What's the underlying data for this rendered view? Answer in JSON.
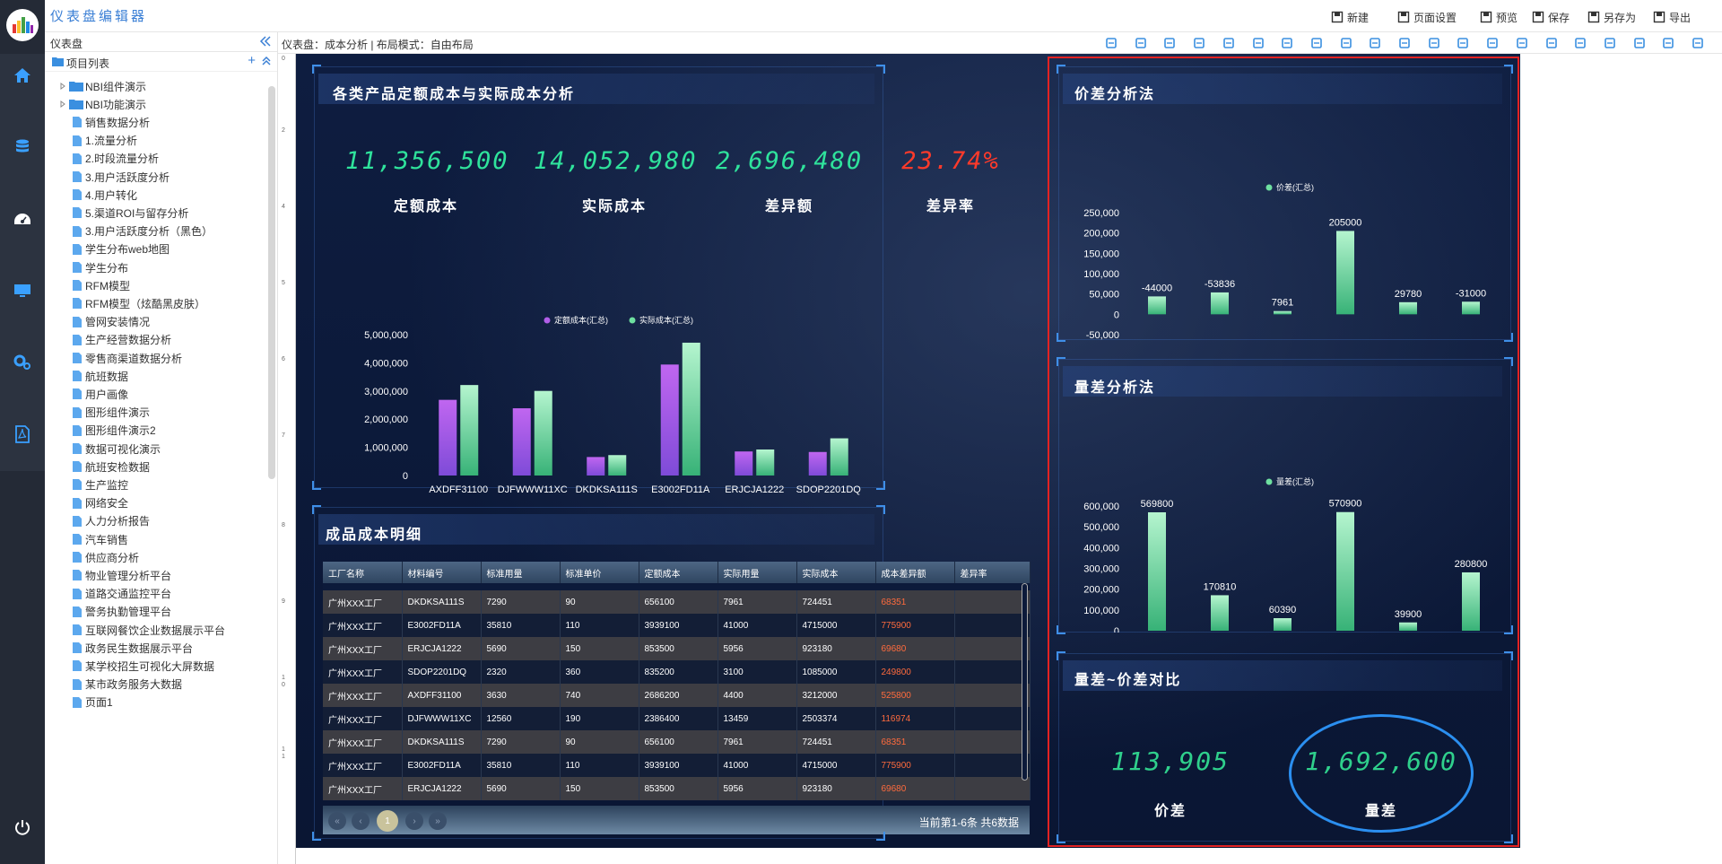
{
  "app": {
    "title": "仪表盘编辑器"
  },
  "toolbar": [
    {
      "key": "new",
      "label": "新建",
      "icon": "new-icon"
    },
    {
      "key": "page-settings",
      "label": "页面设置",
      "icon": "page-settings-icon"
    },
    {
      "key": "preview",
      "label": "预览",
      "icon": "eye-icon"
    },
    {
      "key": "save",
      "label": "保存",
      "icon": "save-icon"
    },
    {
      "key": "save-as",
      "label": "另存为",
      "icon": "save-as-icon"
    },
    {
      "key": "export",
      "label": "导出",
      "icon": "export-icon"
    }
  ],
  "sidebar": {
    "header": "仪表盘",
    "project_list_label": "项目列表",
    "items": [
      {
        "label": "NBI组件演示",
        "type": "folder"
      },
      {
        "label": "NBI功能演示",
        "type": "folder"
      },
      {
        "label": "销售数据分析",
        "type": "doc"
      },
      {
        "label": "1.流量分析",
        "type": "doc"
      },
      {
        "label": "2.时段流量分析",
        "type": "doc"
      },
      {
        "label": "3.用户活跃度分析",
        "type": "doc"
      },
      {
        "label": "4.用户转化",
        "type": "doc"
      },
      {
        "label": "5.渠道ROI与留存分析",
        "type": "doc"
      },
      {
        "label": "3.用户活跃度分析（黑色）",
        "type": "doc"
      },
      {
        "label": "学生分布web地图",
        "type": "doc"
      },
      {
        "label": "学生分布",
        "type": "doc"
      },
      {
        "label": "RFM模型",
        "type": "doc"
      },
      {
        "label": "RFM模型（炫酷黑皮肤）",
        "type": "doc"
      },
      {
        "label": "管网安装情况",
        "type": "doc"
      },
      {
        "label": "生产经营数据分析",
        "type": "doc"
      },
      {
        "label": "零售商渠道数据分析",
        "type": "doc"
      },
      {
        "label": "航班数据",
        "type": "doc"
      },
      {
        "label": "用户画像",
        "type": "doc"
      },
      {
        "label": "图形组件演示",
        "type": "doc"
      },
      {
        "label": "图形组件演示2",
        "type": "doc"
      },
      {
        "label": "数据可视化演示",
        "type": "doc"
      },
      {
        "label": "航班安检数据",
        "type": "doc"
      },
      {
        "label": "生产监控",
        "type": "doc"
      },
      {
        "label": "网络安全",
        "type": "doc"
      },
      {
        "label": "人力分析报告",
        "type": "doc"
      },
      {
        "label": "汽车销售",
        "type": "doc"
      },
      {
        "label": "供应商分析",
        "type": "doc"
      },
      {
        "label": "物业管理分析平台",
        "type": "doc"
      },
      {
        "label": "道路交通监控平台",
        "type": "doc"
      },
      {
        "label": "警务执勤管理平台",
        "type": "doc"
      },
      {
        "label": "互联网餐饮企业数据展示平台",
        "type": "doc"
      },
      {
        "label": "政务民生数据展示平台",
        "type": "doc"
      },
      {
        "label": "某学校招生可视化大屏数据",
        "type": "doc"
      },
      {
        "label": "某市政务服务大数据",
        "type": "doc"
      },
      {
        "label": "页面1",
        "type": "doc"
      }
    ]
  },
  "breadcrumb": "仪表盘：成本分析 | 布局模式：自由布局",
  "tool_icons": [
    "link-icon",
    "undo-icon",
    "redo-icon",
    "copy-icon",
    "cut-icon",
    "paste-icon",
    "lock-icon",
    "unlock-icon",
    "zoom-in-icon",
    "zoom-out-icon",
    "delete-icon",
    "layer-up-icon",
    "layer-top-icon",
    "layer-down-icon",
    "layer-bottom-icon",
    "align-left-icon",
    "align-center-icon",
    "align-right-icon",
    "align-top-icon",
    "align-middle-icon",
    "align-bottom-icon"
  ],
  "ruler": [
    "0",
    "2",
    "4",
    "5",
    "6",
    "7",
    "8",
    "9",
    "1 0",
    "1 1"
  ],
  "panels": {
    "main": {
      "title": "各类产品定额成本与实际成本分析",
      "kpis": [
        {
          "value": "11,356,500",
          "label": "定额成本",
          "color": "#2fe39c"
        },
        {
          "value": "14,052,980",
          "label": "实际成本",
          "color": "#2fe39c"
        },
        {
          "value": "2,696,480",
          "label": "差异额",
          "color": "#2fe39c"
        },
        {
          "value": "23.74%",
          "label": "差异率",
          "color": "#ff3a2a"
        }
      ]
    },
    "detail": {
      "title": "成品成本明细"
    },
    "price": {
      "title": "价差分析法"
    },
    "qty": {
      "title": "量差分析法"
    },
    "compare": {
      "title": "量差~价差对比",
      "items": [
        {
          "value": "113,905",
          "label": "价差"
        },
        {
          "value": "1,692,600",
          "label": "量差"
        }
      ]
    }
  },
  "chart_data": [
    {
      "type": "bar",
      "categories": [
        "AXDFF31100",
        "DJFWWW11XC",
        "DKDKSA111S",
        "E3002FD11A",
        "ERJCJA1222",
        "SDOP2201DQ"
      ],
      "series": [
        {
          "name": "定额成本(汇总)",
          "values": [
            2686200,
            2386400,
            656100,
            3939100,
            853500,
            835200
          ],
          "color": "#b15ee8"
        },
        {
          "name": "实际成本(汇总)",
          "values": [
            3212000,
            3003374,
            724451,
            4715000,
            923180,
            1320000
          ],
          "color": "#6ee0a0"
        }
      ],
      "yticks": [
        "5,000,000",
        "4,000,000",
        "3,000,000",
        "2,000,000",
        "1,000,000",
        "0"
      ],
      "ylim": [
        0,
        5000000
      ],
      "legend": "top-center"
    },
    {
      "type": "bar",
      "categories": [
        "AXDFF31100",
        "DJFWWW11XC",
        "DKDKSA111S",
        "E3002FD11A",
        "ERJCJA1222",
        "SDOP2201DQ"
      ],
      "series": [
        {
          "name": "价差(汇总)",
          "values": [
            -44000,
            -53836,
            7961,
            205000,
            29780,
            -31000
          ],
          "labels": [
            "-44000",
            "-53836",
            "7961",
            "205000",
            "29780",
            "-31000"
          ],
          "color": "#6ee0a0"
        }
      ],
      "yticks": [
        "250,000",
        "200,000",
        "150,000",
        "100,000",
        "50,000",
        "0",
        "-50,000"
      ],
      "ylim": [
        -50000,
        250000
      ],
      "legend": "top-center"
    },
    {
      "type": "bar",
      "categories": [
        "AXDFF31100",
        "DJFWWW11XC",
        "DKDKSA111S",
        "E3002FD11A",
        "ERJCJA1222",
        "SDOP2201DQ"
      ],
      "series": [
        {
          "name": "量差(汇总)",
          "values": [
            569800,
            170810,
            60390,
            570900,
            39900,
            280800
          ],
          "labels": [
            "569800",
            "170810",
            "60390",
            "570900",
            "39900",
            "280800"
          ],
          "color": "#6ee0a0"
        }
      ],
      "yticks": [
        "600,000",
        "500,000",
        "400,000",
        "300,000",
        "200,000",
        "100,000",
        "0"
      ],
      "ylim": [
        0,
        600000
      ],
      "legend": "top-center"
    }
  ],
  "table": {
    "headers": [
      "工厂名称",
      "材料编号",
      "标准用量",
      "标准单价",
      "定额成本",
      "实际用量",
      "实际成本",
      "成本差异额",
      "差异率"
    ],
    "rows": [
      [
        "广州XXX工厂",
        "DKDKSA111S",
        "7290",
        "90",
        "656100",
        "7961",
        "724451",
        "68351",
        ""
      ],
      [
        "广州XXX工厂",
        "E3002FD11A",
        "35810",
        "110",
        "3939100",
        "41000",
        "4715000",
        "775900",
        ""
      ],
      [
        "广州XXX工厂",
        "ERJCJA1222",
        "5690",
        "150",
        "853500",
        "5956",
        "923180",
        "69680",
        ""
      ],
      [
        "广州XXX工厂",
        "SDOP2201DQ",
        "2320",
        "360",
        "835200",
        "3100",
        "1085000",
        "249800",
        ""
      ],
      [
        "广州XXX工厂",
        "AXDFF31100",
        "3630",
        "740",
        "2686200",
        "4400",
        "3212000",
        "525800",
        ""
      ],
      [
        "广州XXX工厂",
        "DJFWWW11XC",
        "12560",
        "190",
        "2386400",
        "13459",
        "2503374",
        "116974",
        ""
      ],
      [
        "广州XXX工厂",
        "DKDKSA111S",
        "7290",
        "90",
        "656100",
        "7961",
        "724451",
        "68351",
        ""
      ],
      [
        "广州XXX工厂",
        "E3002FD11A",
        "35810",
        "110",
        "3939100",
        "41000",
        "4715000",
        "775900",
        ""
      ],
      [
        "广州XXX工厂",
        "ERJCJA1222",
        "5690",
        "150",
        "853500",
        "5956",
        "923180",
        "69680",
        ""
      ]
    ],
    "pager": {
      "current": "1",
      "info": "当前第1-6条 共6数据"
    }
  }
}
